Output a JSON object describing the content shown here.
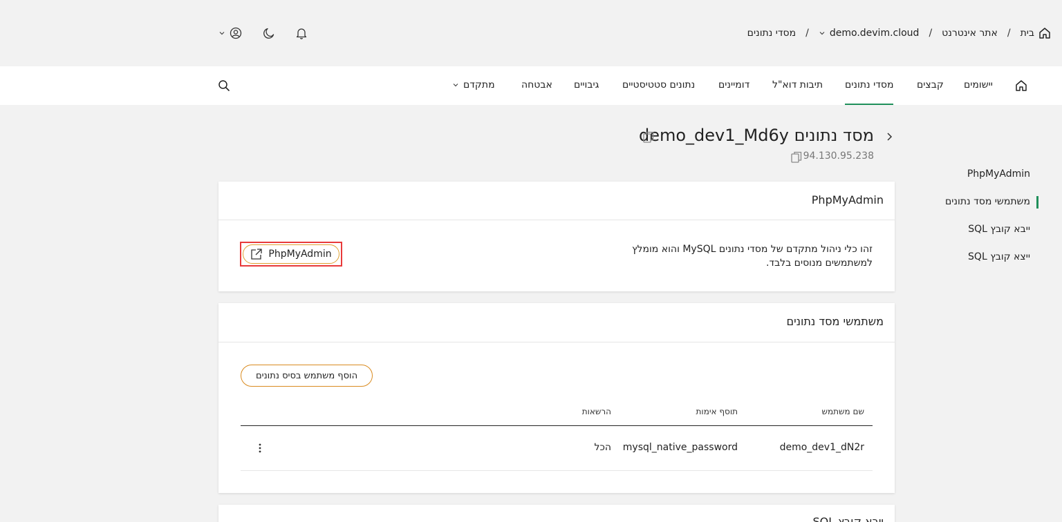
{
  "breadcrumb": {
    "home": "בית",
    "site": "אתר אינטרנט",
    "domain": "demo.devim.cloud",
    "section": "מסדי נתונים",
    "separator": "/"
  },
  "nav": {
    "items": [
      "יישומים",
      "קבצים",
      "מסדי נתונים",
      "תיבות דוא\"ל",
      "דומיינים",
      "נתונים סטטיסטיים",
      "גיבויים",
      "אבטחה",
      "מתקדם"
    ],
    "active": "מסדי נתונים"
  },
  "sidebar": {
    "items": [
      "PhpMyAdmin",
      "משתמשי מסד נתונים",
      "ייבא קובץ SQL",
      "ייצא קובץ SQL"
    ],
    "active": "משתמשי מסד נתונים"
  },
  "page": {
    "title_prefix": "מסד נתונים",
    "db_name": "demo_dev1_Md6y",
    "ip": "94.130.95.238"
  },
  "phpmyadmin_card": {
    "title": "PhpMyAdmin",
    "description": "זהו כלי ניהול מתקדם של מסדי נתונים MySQL והוא מומלץ למשתמשים מנוסים בלבד.",
    "button_label": "PhpMyAdmin"
  },
  "users_card": {
    "title": "משתמשי מסד נתונים",
    "add_button": "הוסף משתמש בסיס נתונים",
    "columns": [
      "שם משתמש",
      "תוסף אימות",
      "הרשאות"
    ],
    "rows": [
      {
        "username": "demo_dev1_dN2r",
        "auth_plugin": "mysql_native_password",
        "permissions": "הכל"
      }
    ]
  },
  "next_card": {
    "title": "ייבא קובץ SQL"
  },
  "colors": {
    "accent": "#1f8f5a",
    "button_border": "#d98a1e",
    "highlight": "#e83a3a"
  }
}
